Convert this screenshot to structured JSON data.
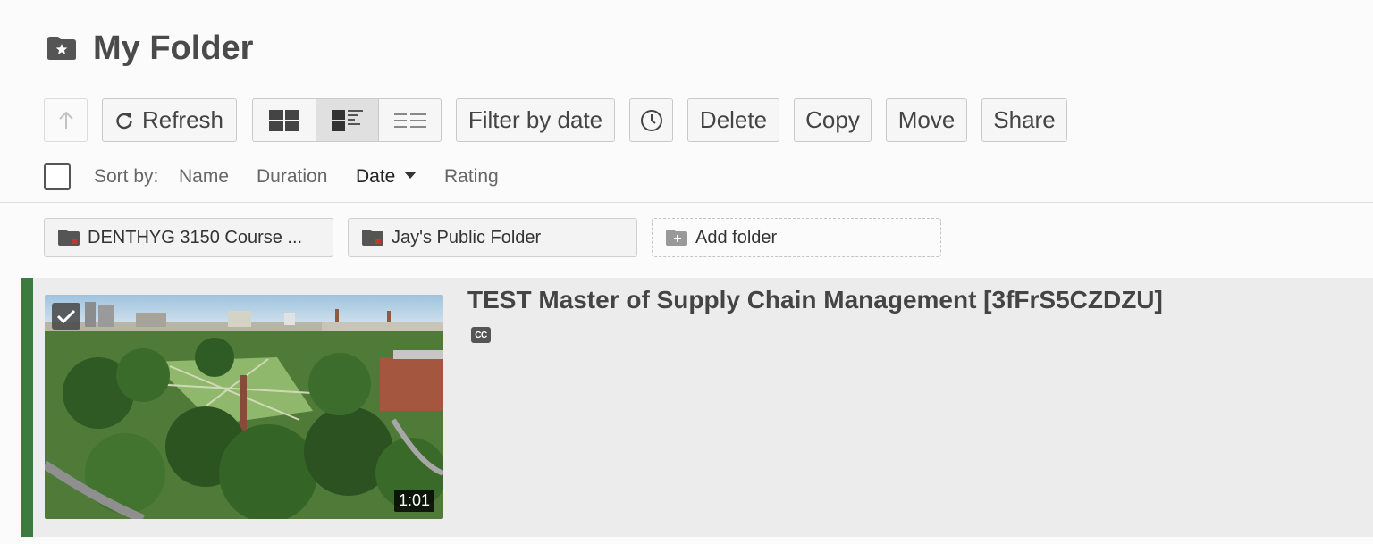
{
  "header": {
    "title": "My Folder",
    "icon": "folder-star-icon"
  },
  "toolbar": {
    "up_icon": "arrow-up-icon",
    "refresh_label": "Refresh",
    "refresh_icon": "refresh-icon",
    "views": [
      {
        "name": "grid-view",
        "icon": "grid-view-icon",
        "active": false
      },
      {
        "name": "detail-view",
        "icon": "detail-view-icon",
        "active": true
      },
      {
        "name": "list-view",
        "icon": "list-view-icon",
        "active": false
      }
    ],
    "filter_label": "Filter by date",
    "clock_icon": "clock-icon",
    "delete_label": "Delete",
    "copy_label": "Copy",
    "move_label": "Move",
    "share_label": "Share"
  },
  "sort": {
    "label": "Sort by:",
    "options": [
      "Name",
      "Duration",
      "Date",
      "Rating"
    ],
    "active": "Date",
    "direction": "descending"
  },
  "folders": [
    {
      "label": "DENTHYG 3150 Course ...",
      "icon": "folder-icon"
    },
    {
      "label": "Jay's Public Folder",
      "icon": "folder-icon"
    }
  ],
  "add_folder": {
    "label": "Add folder",
    "icon": "add-folder-icon"
  },
  "videos": [
    {
      "title": "TEST Master of Supply Chain Management [3fFrS5CZDZU]",
      "duration": "1:01",
      "selected": true,
      "captions_badge": "CC"
    }
  ],
  "colors": {
    "accent_green": "#3d7a3f",
    "folder_red": "#c0392b",
    "text_dark": "#444444"
  }
}
